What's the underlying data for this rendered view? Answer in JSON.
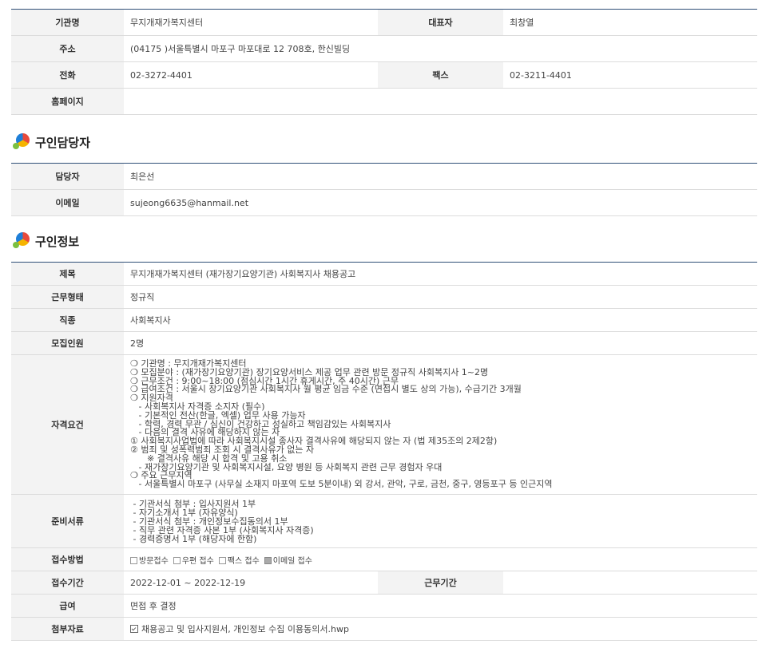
{
  "org": {
    "name_label": "기관명",
    "name": "무지개재가복지센터",
    "rep_label": "대표자",
    "rep": "최창열",
    "addr_label": "주소",
    "addr": "(04175 )서울특별시 마포구 마포대로 12 708호, 한신빌딩",
    "phone_label": "전화",
    "phone": "02-3272-4401",
    "fax_label": "팩스",
    "fax": "02-3211-4401",
    "homepage_label": "홈페이지",
    "homepage": ""
  },
  "contact": {
    "section_title": "구인담당자",
    "person_label": "담당자",
    "person": "최은선",
    "email_label": "이메일",
    "email": "sujeong6635@hanmail.net"
  },
  "job": {
    "section_title": "구인정보",
    "title_label": "제목",
    "title": "무지개재가복지센터 (재가장기요양기관) 사회복지사 채용공고",
    "type_label": "근무형태",
    "type": "정규직",
    "category_label": "직종",
    "category": "사회복지사",
    "headcount_label": "모집인원",
    "headcount": "2명",
    "requirements_label": "자격요건",
    "requirements": [
      "❍ 기관명 : 무지개재가복지센터",
      "❍ 모집분야 : (재가장기요양기관) 장기요양서비스 제공 업무 관련 방문 정규직 사회복지사 1~2명",
      "❍ 근무조건 : 9:00~18:00 (점심시간 1시간 휴게시간, 주 40시간) 근무",
      "❍ 급여조건 : 서울시 장기요양기관 사회복지사 월 평균 임금 수준 (면접시 별도 상의 가능), 수급기간 3개월",
      "❍ 지원자격",
      "   - 사회복지사 자격증 소지자 (필수)",
      "   - 기본적인 전산(한글, 엑셀) 업무 사용 가능자",
      "   - 학력, 경력 무관 / 심신이 건강하고 성실하고 책임감있는 사회복지사",
      "   - 다음의 결격 사유에 해당하지 않는 자",
      "① 사회복지사업법에 따라 사회복지시설 종사자 결격사유에 해당되지 않는 자 (법 제35조의 2제2항)",
      "② 범죄 및 성폭력범죄 조회 시 결격사유가 없는 자",
      "      ※ 결격사유 해당 시 합격 및 고용 취소",
      "   - 재가장기요양기관 및 사회복지시설, 요양 병원 등 사회복지 관련 근무 경험자 우대",
      "❍ 주요 근무지역",
      "   - 서울특별시 마포구 (사무실 소재지 마포역 도보 5분이내) 외 강서, 관악, 구로, 금천, 중구, 영등포구 등 인근지역"
    ],
    "documents_label": "준비서류",
    "documents": [
      " - 기관서식 첨부 : 입사지원서 1부",
      " - 자기소개서 1부 (자유양식)",
      " - 기관서식 첨부 : 개인정보수집동의서 1부",
      " - 직무 관련 자격증 사본 1부 (사회복지사 자격증)",
      " - 경력증명서 1부 (해당자에 한함)"
    ],
    "method_label": "접수방법",
    "methods": [
      {
        "label": "방문접수",
        "checked": false
      },
      {
        "label": "우편 접수",
        "checked": false
      },
      {
        "label": "팩스 접수",
        "checked": false
      },
      {
        "label": "이메일 접수",
        "checked": true
      }
    ],
    "period_label": "접수기간",
    "period": "2022-12-01 ~ 2022-12-19",
    "work_period_label": "근무기간",
    "work_period": "",
    "salary_label": "급여",
    "salary": "면접 후 결정",
    "attach_label": "첨부자료",
    "attach": "채용공고 및 입사지원서, 개인정보 수집 이용동의서.hwp"
  }
}
